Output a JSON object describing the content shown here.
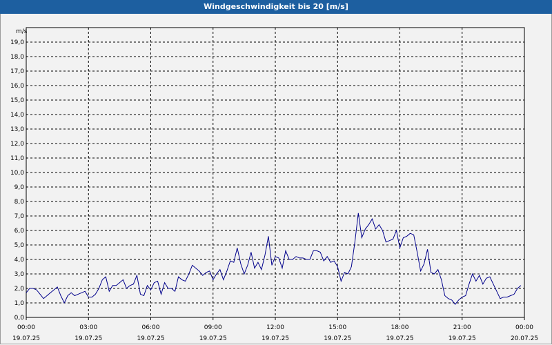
{
  "window": {
    "title": "Windgeschwindigkeit bis 20 [m/s]"
  },
  "chart_data": {
    "type": "line",
    "title": "Windgeschwindigkeit bis 20 [m/s]",
    "ylabel": "m/s",
    "ylim": [
      0,
      20
    ],
    "yticks": [
      "0,0",
      "1,0",
      "2,0",
      "3,0",
      "4,0",
      "5,0",
      "6,0",
      "7,0",
      "8,0",
      "9,0",
      "10,0",
      "11,0",
      "12,0",
      "13,0",
      "14,0",
      "15,0",
      "16,0",
      "17,0",
      "18,0",
      "19,0"
    ],
    "xlim": [
      "19.07.25 00:00",
      "20.07.25 00:00"
    ],
    "xticks": [
      {
        "time": "00:00",
        "date": "19.07.25"
      },
      {
        "time": "03:00",
        "date": "19.07.25"
      },
      {
        "time": "06:00",
        "date": "19.07.25"
      },
      {
        "time": "09:00",
        "date": "19.07.25"
      },
      {
        "time": "12:00",
        "date": "19.07.25"
      },
      {
        "time": "15:00",
        "date": "19.07.25"
      },
      {
        "time": "18:00",
        "date": "19.07.25"
      },
      {
        "time": "21:00",
        "date": "19.07.25"
      },
      {
        "time": "00:00",
        "date": "20.07.25"
      }
    ],
    "grid": true,
    "line_color": "#00008b",
    "series": [
      {
        "x": [
          "00:00",
          "00:10",
          "00:20",
          "00:30",
          "00:40",
          "00:50",
          "01:00",
          "01:10",
          "01:20",
          "01:30",
          "01:40",
          "01:50",
          "02:00",
          "02:10",
          "02:20",
          "02:30",
          "02:40",
          "02:50",
          "03:00",
          "03:10",
          "03:20",
          "03:30",
          "03:40",
          "03:50",
          "04:00",
          "04:10",
          "04:20",
          "04:30",
          "04:40",
          "04:50",
          "05:00",
          "05:10",
          "05:20",
          "05:30",
          "05:40",
          "05:50",
          "06:00",
          "06:10",
          "06:20",
          "06:30",
          "06:40",
          "06:50",
          "07:00",
          "07:10",
          "07:20",
          "07:30",
          "07:40",
          "07:50",
          "08:00",
          "08:10",
          "08:20",
          "08:30",
          "08:40",
          "08:50",
          "09:00",
          "09:10",
          "09:20",
          "09:30",
          "09:40",
          "09:50",
          "10:00",
          "10:10",
          "10:20",
          "10:30",
          "10:40",
          "10:50",
          "11:00",
          "11:10",
          "11:20",
          "11:30",
          "11:40",
          "11:50",
          "12:00",
          "12:10",
          "12:20",
          "12:30",
          "12:40",
          "12:50",
          "13:00",
          "13:10",
          "13:20",
          "13:30",
          "13:40",
          "13:50",
          "14:00",
          "14:10",
          "14:20",
          "14:30",
          "14:40",
          "14:50",
          "15:00",
          "15:10",
          "15:20",
          "15:30",
          "15:40",
          "15:50",
          "16:00",
          "16:10",
          "16:20",
          "16:30",
          "16:40",
          "16:50",
          "17:00",
          "17:10",
          "17:20",
          "17:30",
          "17:40",
          "17:50",
          "18:00",
          "18:10",
          "18:20",
          "18:30",
          "18:40",
          "18:50",
          "19:00",
          "19:10",
          "19:20",
          "19:30",
          "19:40",
          "19:50",
          "20:00",
          "20:10",
          "20:20",
          "20:30",
          "20:40",
          "20:50",
          "21:00",
          "21:10",
          "21:20",
          "21:30",
          "21:40",
          "21:50",
          "22:00",
          "22:10",
          "22:20",
          "22:30",
          "22:40",
          "22:50",
          "23:00",
          "23:10",
          "23:20",
          "23:30",
          "23:40",
          "23:50"
        ],
        "values": [
          1.7,
          2.0,
          2.0,
          1.9,
          1.6,
          1.3,
          1.5,
          1.7,
          1.9,
          2.1,
          1.5,
          1.0,
          1.5,
          1.7,
          1.5,
          1.6,
          1.7,
          1.8,
          1.4,
          1.4,
          1.6,
          2.0,
          2.6,
          2.8,
          1.8,
          2.2,
          2.2,
          2.4,
          2.6,
          2.0,
          2.2,
          2.3,
          2.9,
          1.6,
          1.5,
          2.2,
          1.9,
          2.4,
          2.5,
          1.6,
          2.4,
          2.0,
          2.0,
          1.8,
          2.8,
          2.6,
          2.5,
          3.0,
          3.6,
          3.4,
          3.2,
          2.9,
          3.1,
          3.2,
          2.6,
          3.0,
          3.3,
          2.6,
          3.2,
          3.9,
          3.8,
          4.8,
          3.7,
          3.0,
          3.6,
          4.5,
          3.4,
          3.8,
          3.3,
          4.3,
          5.6,
          3.6,
          4.2,
          4.1,
          3.4,
          4.6,
          4.0,
          4.0,
          4.2,
          4.1,
          4.1,
          4.0,
          4.0,
          4.6,
          4.6,
          4.5,
          3.9,
          4.2,
          3.8,
          3.9,
          3.5,
          2.5,
          3.1,
          3.0,
          3.5,
          5.2,
          7.2,
          5.5,
          6.1,
          6.4,
          6.8,
          6.1,
          6.4,
          6.0,
          5.2,
          5.3,
          5.4,
          6.0,
          4.8,
          5.5,
          5.6,
          5.8,
          5.7,
          4.5,
          3.2,
          3.7,
          4.7,
          3.1,
          3.0,
          3.3,
          2.6,
          1.5,
          1.3,
          1.2,
          0.9,
          1.2,
          1.4,
          1.5,
          2.3,
          3.0,
          2.5,
          2.9,
          2.3,
          2.7,
          2.8,
          2.3,
          1.8,
          1.3,
          1.4,
          1.4,
          1.5,
          1.6,
          2.0,
          2.2
        ]
      }
    ]
  }
}
